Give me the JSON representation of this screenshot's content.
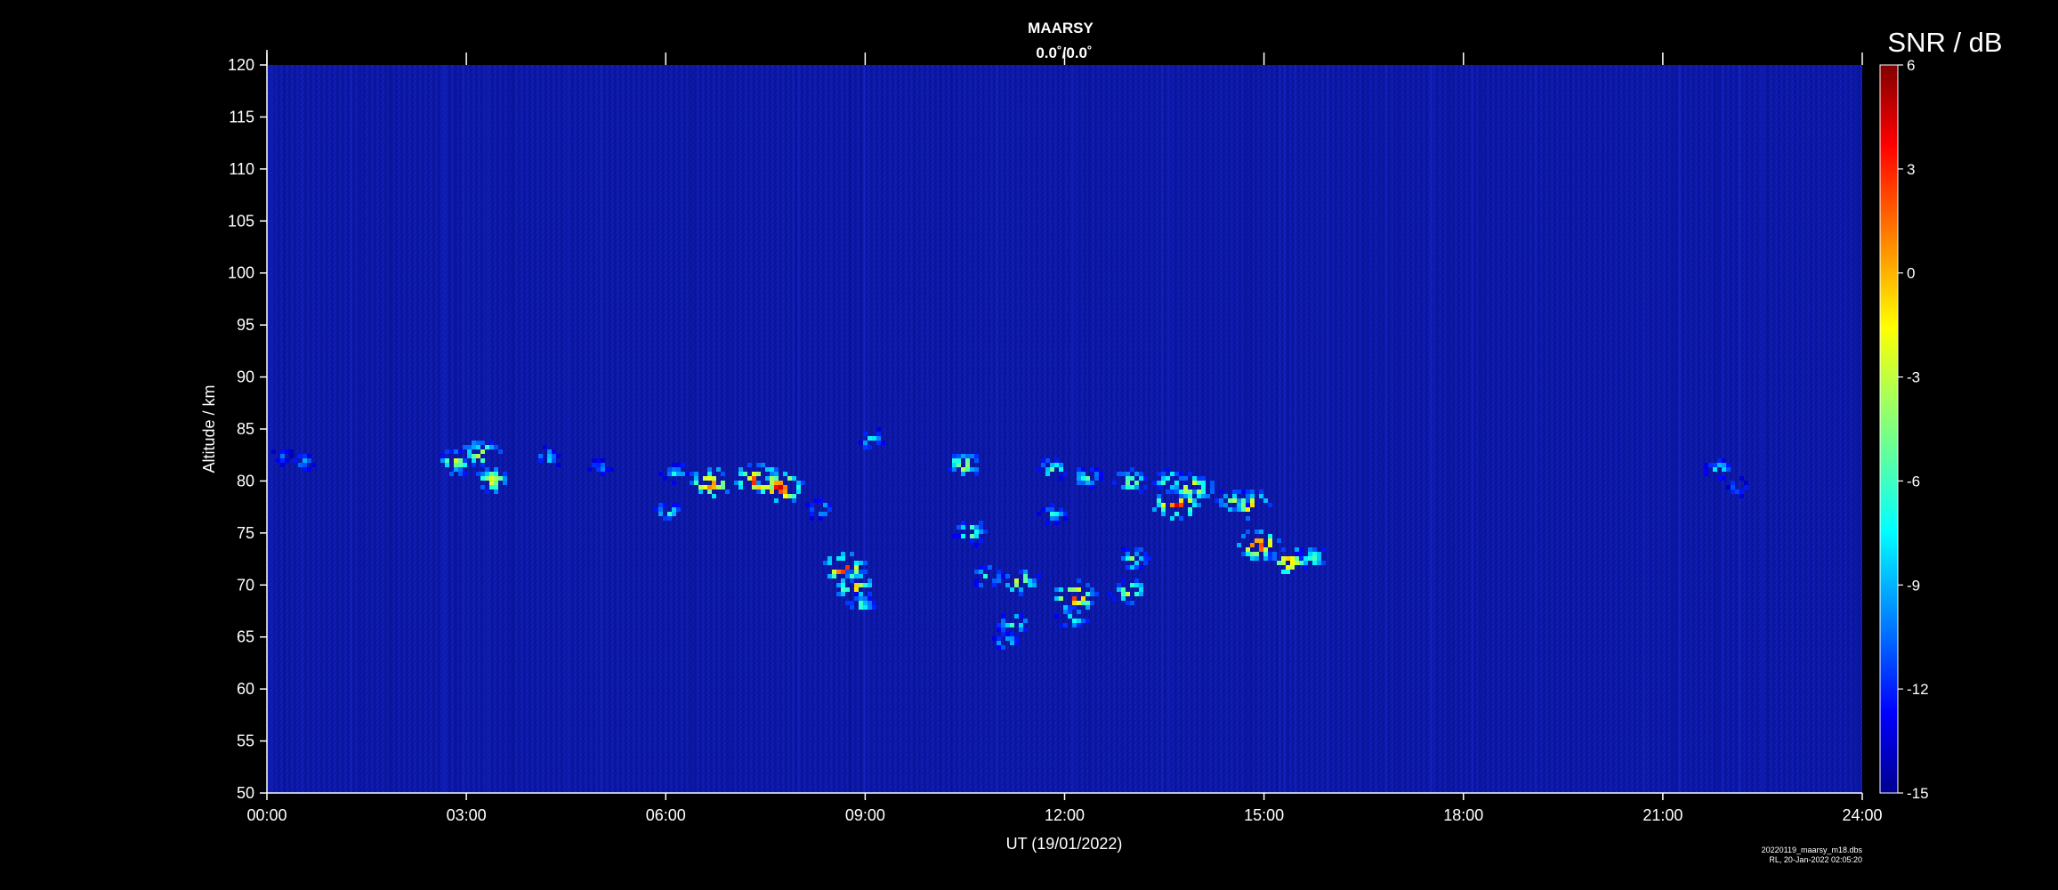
{
  "chart_data": {
    "type": "heatmap",
    "title": "MAARSY",
    "subtitle": "0.0˚/0.0˚",
    "xlabel": "UT (19/01/2022)",
    "ylabel": "Altitude / km",
    "x_ticks": [
      "00:00",
      "03:00",
      "06:00",
      "09:00",
      "12:00",
      "15:00",
      "18:00",
      "21:00",
      "24:00"
    ],
    "xlim_hours": [
      0,
      24
    ],
    "y_ticks": [
      50,
      55,
      60,
      65,
      70,
      75,
      80,
      85,
      90,
      95,
      100,
      105,
      110,
      115,
      120
    ],
    "ylim": [
      50,
      120
    ],
    "colorbar": {
      "label": "SNR / dB",
      "ticks": [
        6,
        3,
        0,
        -3,
        -6,
        -9,
        -12,
        -15
      ],
      "range": [
        -15,
        6
      ],
      "colormap": "jet"
    },
    "background_snr_db": -13.5,
    "echoes": [
      {
        "t": 0.2,
        "alt": 82.5,
        "snr": -9
      },
      {
        "t": 0.55,
        "alt": 82,
        "snr": -8
      },
      {
        "t": 2.8,
        "alt": 82,
        "snr": -2
      },
      {
        "t": 3.2,
        "alt": 82.8,
        "snr": 0
      },
      {
        "t": 3.35,
        "alt": 80.3,
        "snr": -1
      },
      {
        "t": 4.2,
        "alt": 82.5,
        "snr": -7
      },
      {
        "t": 5.0,
        "alt": 81.5,
        "snr": -8
      },
      {
        "t": 6.1,
        "alt": 81,
        "snr": -6
      },
      {
        "t": 6.0,
        "alt": 77.2,
        "snr": -5
      },
      {
        "t": 6.65,
        "alt": 80,
        "snr": 3
      },
      {
        "t": 7.35,
        "alt": 80.2,
        "snr": 5
      },
      {
        "t": 7.7,
        "alt": 79.5,
        "snr": 5
      },
      {
        "t": 8.3,
        "alt": 77.5,
        "snr": -6
      },
      {
        "t": 8.65,
        "alt": 71.8,
        "snr": 4
      },
      {
        "t": 8.8,
        "alt": 70.2,
        "snr": 1
      },
      {
        "t": 8.9,
        "alt": 68.3,
        "snr": -5
      },
      {
        "t": 9.05,
        "alt": 84.2,
        "snr": -6
      },
      {
        "t": 10.45,
        "alt": 81.8,
        "snr": -1
      },
      {
        "t": 10.55,
        "alt": 75.3,
        "snr": -3
      },
      {
        "t": 10.8,
        "alt": 71,
        "snr": -4
      },
      {
        "t": 11.3,
        "alt": 70.5,
        "snr": -1
      },
      {
        "t": 11.2,
        "alt": 66.5,
        "snr": -4
      },
      {
        "t": 11.1,
        "alt": 64.8,
        "snr": -6
      },
      {
        "t": 11.8,
        "alt": 81.3,
        "snr": -4
      },
      {
        "t": 12.3,
        "alt": 80.6,
        "snr": -5
      },
      {
        "t": 11.8,
        "alt": 77,
        "snr": -6
      },
      {
        "t": 12.1,
        "alt": 69,
        "snr": 4
      },
      {
        "t": 12.1,
        "alt": 67,
        "snr": -4
      },
      {
        "t": 12.95,
        "alt": 80.2,
        "snr": -2
      },
      {
        "t": 13.0,
        "alt": 72.7,
        "snr": -3
      },
      {
        "t": 12.95,
        "alt": 69.5,
        "snr": -1
      },
      {
        "t": 13.55,
        "alt": 80.2,
        "snr": -3
      },
      {
        "t": 13.65,
        "alt": 78,
        "snr": 5
      },
      {
        "t": 13.9,
        "alt": 79.5,
        "snr": 1
      },
      {
        "t": 14.5,
        "alt": 78.3,
        "snr": -3
      },
      {
        "t": 14.8,
        "alt": 77.8,
        "snr": 1
      },
      {
        "t": 14.9,
        "alt": 74,
        "snr": 4
      },
      {
        "t": 15.35,
        "alt": 72.5,
        "snr": 2
      },
      {
        "t": 15.7,
        "alt": 72.9,
        "snr": -4
      },
      {
        "t": 21.8,
        "alt": 81.3,
        "snr": -6
      },
      {
        "t": 22.1,
        "alt": 79.6,
        "snr": -9
      }
    ]
  },
  "footer": {
    "filename": "20220119_maarsy_m18.dbs",
    "stamp": "RL, 20-Jan-2022 02:05:20"
  }
}
